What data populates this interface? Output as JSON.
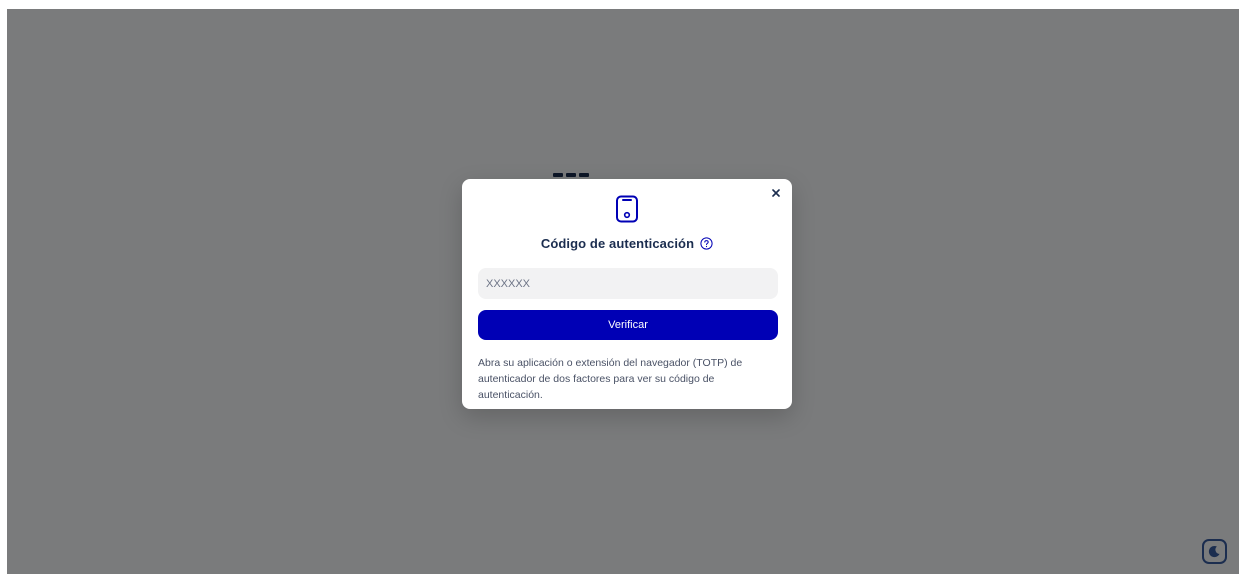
{
  "modal": {
    "icon": "smartphone-icon",
    "title": "Código de autenticación",
    "help_icon": "question-circle-icon",
    "close_icon": "close-icon",
    "code_input": {
      "placeholder": "XXXXXX",
      "value": ""
    },
    "verify_label": "Verificar",
    "description": "Abra su aplicación o extensión del navegador (TOTP) de autenticador de dos factores para ver su código de autenticación."
  },
  "theme_toggle": {
    "icon": "moon-icon"
  },
  "colors": {
    "accent": "#0000b5",
    "title": "#1b2d4f",
    "overlay": "rgba(0,0,0,0.5)",
    "input_background": "#f2f2f3"
  }
}
